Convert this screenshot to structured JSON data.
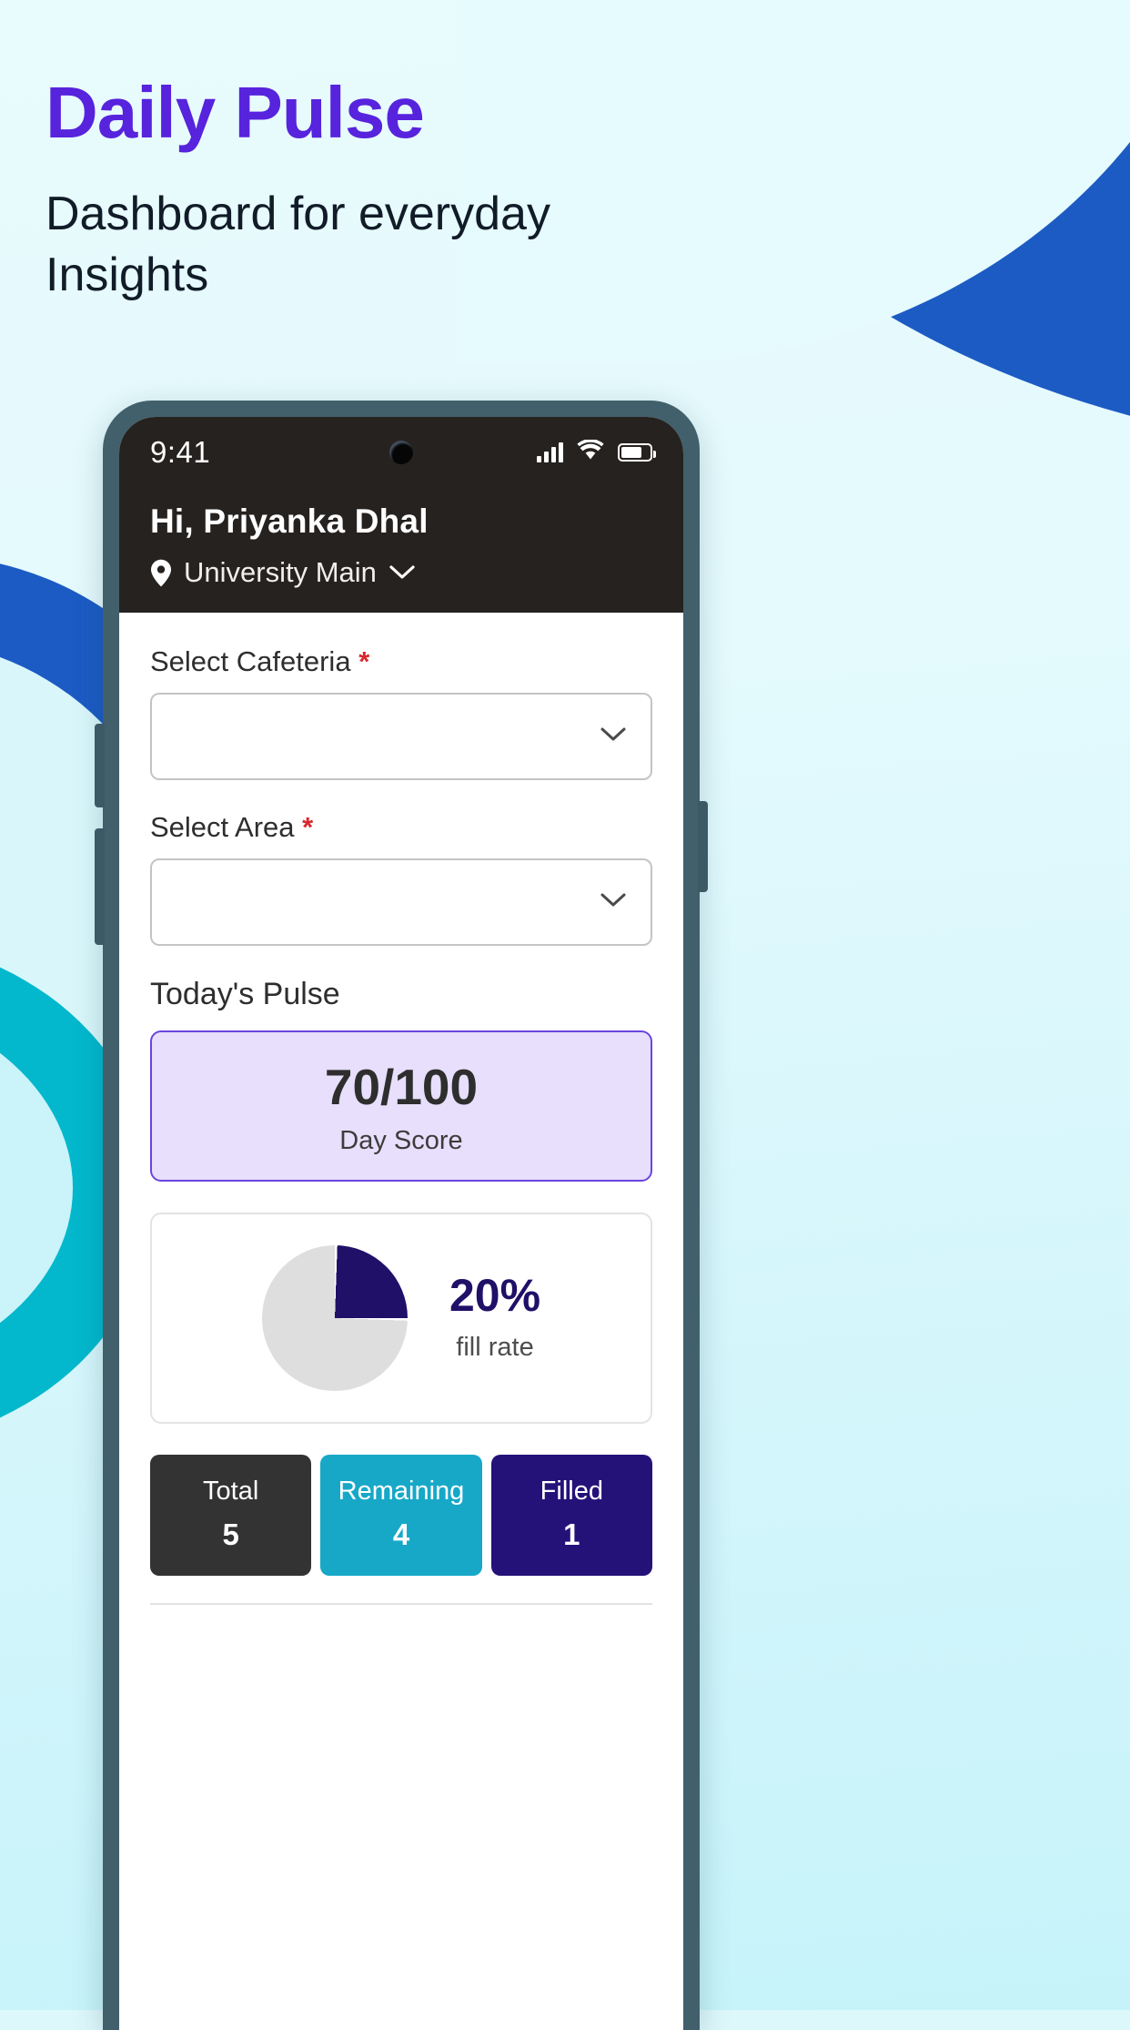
{
  "promo": {
    "headline": "Daily Pulse",
    "subhead": "Dashboard for everyday Insights",
    "headline_color": "#5723dd",
    "subhead_color": "#111c28",
    "background_color": "#ddf8fb",
    "accent_blue": "#1c5bc4",
    "accent_teal": "#03b8cd"
  },
  "status_bar": {
    "time": "9:41",
    "signal_icon": "cellular-signal-icon",
    "wifi_icon": "wifi-icon",
    "battery_icon": "battery-icon",
    "battery_level": "75%"
  },
  "header": {
    "greeting": "Hi, Priyanka Dhal",
    "location_icon": "location-pin-icon",
    "location": "University Main",
    "location_chevron": "chevron-down-icon",
    "background_color": "#262220"
  },
  "form": {
    "cafeteria": {
      "label": "Select Cafeteria",
      "required_mark": "*",
      "value": "",
      "placeholder": "",
      "chevron": "chevron-down-icon"
    },
    "area": {
      "label": "Select Area",
      "required_mark": "*",
      "value": "",
      "placeholder": "",
      "chevron": "chevron-down-icon"
    }
  },
  "pulse": {
    "section_title": "Today's Pulse",
    "score_value": "70/100",
    "score_label": "Day Score",
    "score_card_bg": "#e8dffc",
    "score_card_border": "#6a45e0"
  },
  "chart_data": {
    "type": "pie",
    "title": "fill rate",
    "categories": [
      "Filled",
      "Remaining"
    ],
    "values": [
      20,
      80
    ],
    "value_label": "20%",
    "sublabel": "fill rate",
    "colors": [
      "#201068",
      "#dedede"
    ],
    "legend": "none"
  },
  "stats": [
    {
      "label": "Total",
      "value": "5",
      "color": "#333333"
    },
    {
      "label": "Remaining",
      "value": "4",
      "color": "#17a8c8"
    },
    {
      "label": "Filled",
      "value": "1",
      "color": "#241279"
    }
  ]
}
